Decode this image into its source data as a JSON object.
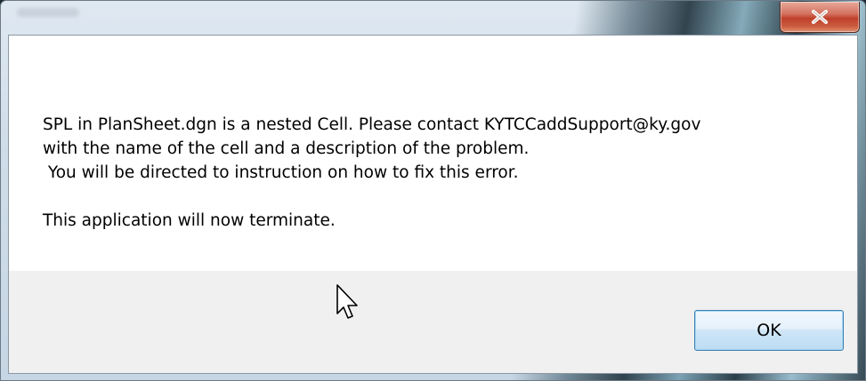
{
  "dialog": {
    "message": "SPL in PlanSheet.dgn is a nested Cell. Please contact KYTCCaddSupport@ky.gov\nwith the name of the cell and a description of the problem.\n You will be directed to instruction on how to fix this error.\n\nThis application will now terminate.",
    "ok_label": "OK"
  },
  "icons": {
    "close": "close-icon",
    "cursor": "mouse-pointer-icon"
  },
  "colors": {
    "close_button": "#c0412b",
    "ok_border": "#3c7fb1",
    "button_area": "#f0f0f0"
  }
}
